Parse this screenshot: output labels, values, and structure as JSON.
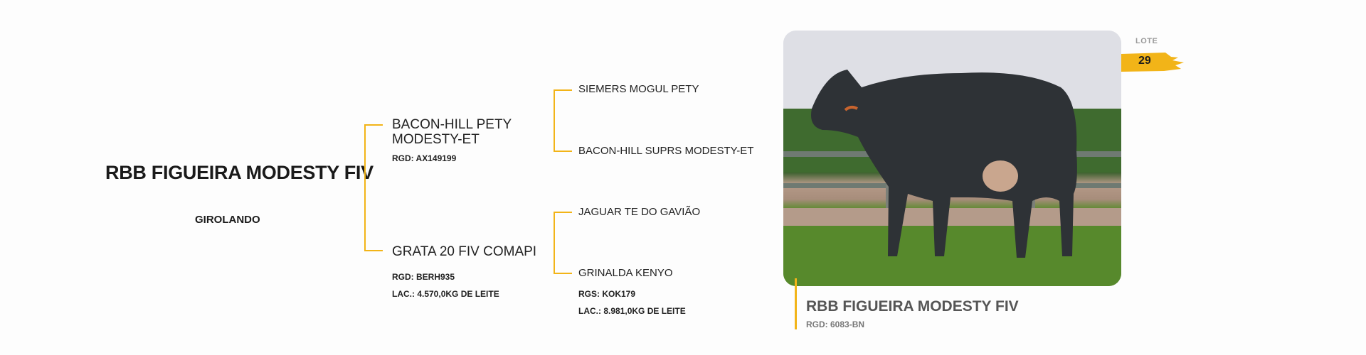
{
  "animal": {
    "name": "RBB FIGUEIRA MODESTY FIV",
    "breed": "GIROLANDO"
  },
  "sire": {
    "name": "BACON-HILL PETY MODESTY-ET",
    "name_line1": "BACON-HILL PETY",
    "name_line2": "MODESTY-ET",
    "rgd": "RGD: AX149199",
    "sire": "SIEMERS MOGUL PETY",
    "dam": "BACON-HILL SUPRS MODESTY-ET"
  },
  "dam": {
    "name": "GRATA 20 FIV COMAPI",
    "rgd": "RGD: BERH935",
    "lac": "LAC.: 4.570,0KG DE LEITE",
    "sire": "JAGUAR TE DO GAVIÃO",
    "dam": "GRINALDA KENYO",
    "dam_rgs": "RGS: KOK179",
    "dam_lac": "LAC.:  8.981,0KG DE LEITE"
  },
  "lot": {
    "label": "LOTE",
    "number": "29"
  },
  "photo": {
    "subject": "cow-photo",
    "caption_name": "RBB FIGUEIRA MODESTY FIV",
    "caption_rgd": "RGD: 6083-BN"
  },
  "colors": {
    "accent": "#f2b418",
    "text": "#1a1a1a",
    "muted": "#777777"
  }
}
